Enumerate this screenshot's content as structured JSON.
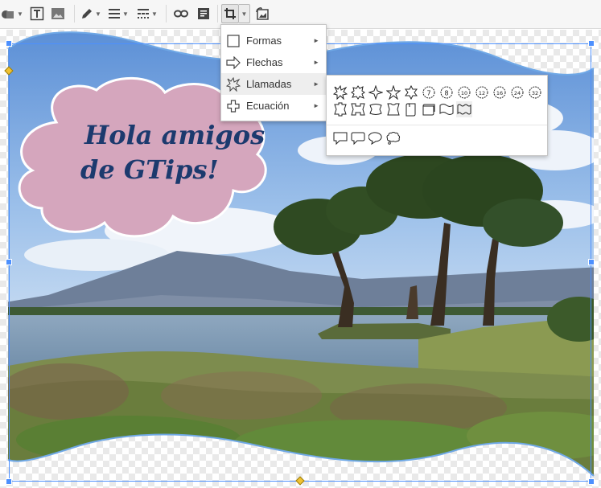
{
  "menu": {
    "items": [
      {
        "label": "Formas",
        "icon": "square-icon",
        "arrow": "►"
      },
      {
        "label": "Flechas",
        "icon": "arrow-right-icon",
        "arrow": "►"
      },
      {
        "label": "Llamadas",
        "icon": "callout-explosion-icon",
        "arrow": "►"
      },
      {
        "label": "Ecuación",
        "icon": "plus-icon",
        "arrow": "►"
      }
    ],
    "active_item": "Llamadas"
  },
  "callouts_submenu": {
    "row1": [
      "explosion1",
      "explosion2",
      "four-point-star",
      "five-point-star",
      "six-point-star",
      "7",
      "8",
      "10",
      "12",
      "16",
      "24",
      "32"
    ],
    "row2": [
      "ribbon",
      "ribbon2",
      "curved-ribbon",
      "curved-ribbon2",
      "vertical-scroll",
      "horizontal-scroll",
      "wave",
      "double-wave"
    ],
    "row3": [
      "wedge-rect-callout",
      "wedge-round-rect-callout",
      "wedge-ellipse-callout",
      "cloud-callout"
    ]
  },
  "canvas": {
    "cloud_text_line1": "Hola amigos",
    "cloud_text_line2": "de GTips!"
  },
  "colors": {
    "selection": "#4d90fe",
    "cloud_fill": "#d5a6bd",
    "cloud_text": "#1c3a6e",
    "menu_hover": "#eeeeee"
  },
  "toolbar": {
    "icons": [
      "shape-icon",
      "text-box-icon",
      "image-icon",
      "pen-icon",
      "line-weight-icon",
      "line-dash-icon",
      "link-icon",
      "comment-icon",
      "crop-icon",
      "replace-image-icon"
    ]
  }
}
